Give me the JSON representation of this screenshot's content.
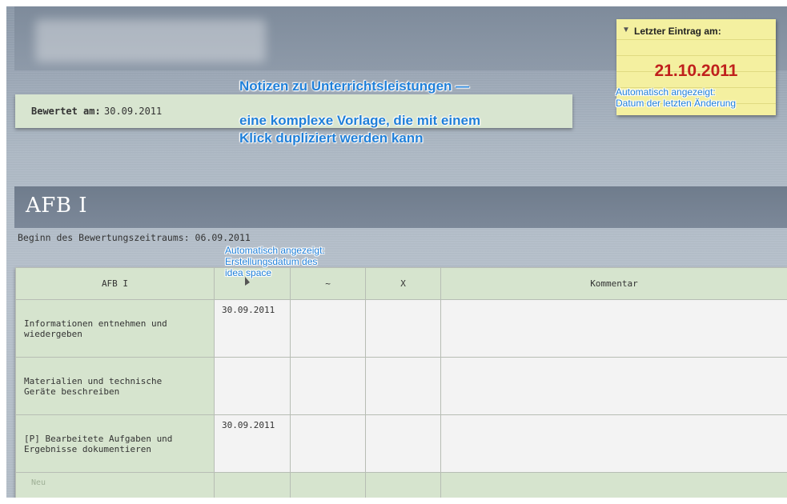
{
  "header": {
    "bewertet_label": "Bewertet am:",
    "bewertet_value": "30.09.2011"
  },
  "callouts": {
    "main_line1": "Notizen zu Unterrichtsleistungen —",
    "main_line2": "eine komplexe Vorlage, die mit einem",
    "main_line3": "Klick dupliziert werden kann",
    "sticky_line1": "Automatisch angezeigt:",
    "sticky_line2": "Datum der letzten Änderung",
    "created_line1": "Automatisch angezeigt:",
    "created_line2": "Erstellungsdatum des",
    "created_line3": "idea space"
  },
  "sticky": {
    "title": "Letzter Eintrag am:",
    "date": "21.10.2011",
    "date_color": "#c0201c"
  },
  "section": {
    "title": "AFB I",
    "begin_label": "Beginn des Bewertungszeitraums: 06.09.2011"
  },
  "table": {
    "headers": [
      "AFB I",
      "",
      "~",
      "X",
      "Kommentar"
    ],
    "rows": [
      {
        "label_line1": "Informationen entnehmen und",
        "label_line2": "wiedergeben",
        "date": "30.09.2011"
      },
      {
        "label_line1": "Materialien und technische",
        "label_line2": "Geräte beschreiben",
        "date": ""
      },
      {
        "label_line1": "[P] Bearbeitete Aufgaben und",
        "label_line2": "Ergebnisse dokumentieren",
        "date": "30.09.2011"
      }
    ],
    "new_row_placeholder": "Neu"
  },
  "colors": {
    "accent_green": "#d6e4ce",
    "callout_blue": "#1f7fd8",
    "sticky_yellow": "#f4f0a0"
  }
}
